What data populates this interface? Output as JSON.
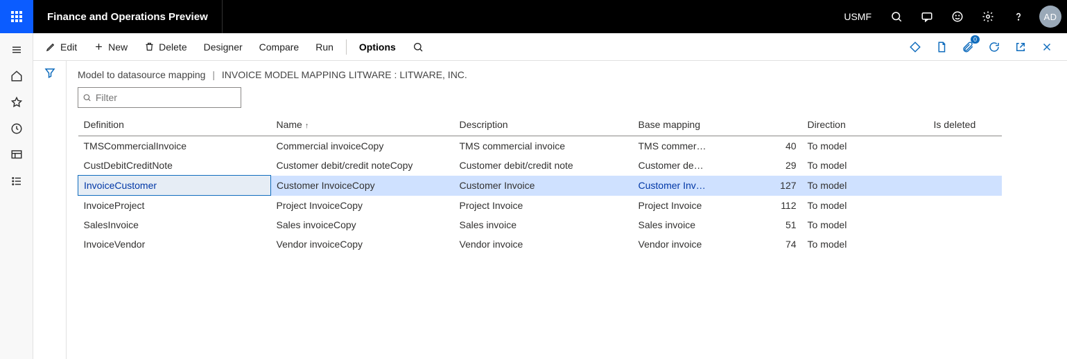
{
  "topbar": {
    "product": "Finance and Operations Preview",
    "company": "USMF",
    "avatar": "AD"
  },
  "toolbar": {
    "edit": "Edit",
    "new": "New",
    "delete": "Delete",
    "designer": "Designer",
    "compare": "Compare",
    "run": "Run",
    "options": "Options",
    "attach_badge": "0"
  },
  "breadcrumb": {
    "a": "Model to datasource mapping",
    "b": "INVOICE MODEL MAPPING LITWARE : LITWARE, INC."
  },
  "filter": {
    "placeholder": "Filter"
  },
  "columns": {
    "definition": "Definition",
    "name": "Name",
    "description": "Description",
    "base": "Base mapping",
    "direction": "Direction",
    "deleted": "Is deleted"
  },
  "rows": [
    {
      "definition": "TMSCommercialInvoice",
      "name": "Commercial invoiceCopy",
      "description": "TMS commercial invoice",
      "base": "TMS commer…",
      "num": "40",
      "direction": "To model",
      "deleted": ""
    },
    {
      "definition": "CustDebitCreditNote",
      "name": "Customer debit/credit noteCopy",
      "description": "Customer debit/credit note",
      "base": "Customer de…",
      "num": "29",
      "direction": "To model",
      "deleted": ""
    },
    {
      "definition": "InvoiceCustomer",
      "name": "Customer InvoiceCopy",
      "description": "Customer Invoice",
      "base": "Customer Inv…",
      "num": "127",
      "direction": "To model",
      "deleted": ""
    },
    {
      "definition": "InvoiceProject",
      "name": "Project InvoiceCopy",
      "description": "Project Invoice",
      "base": "Project Invoice",
      "num": "112",
      "direction": "To model",
      "deleted": ""
    },
    {
      "definition": "SalesInvoice",
      "name": "Sales invoiceCopy",
      "description": "Sales invoice",
      "base": "Sales invoice",
      "num": "51",
      "direction": "To model",
      "deleted": ""
    },
    {
      "definition": "InvoiceVendor",
      "name": "Vendor invoiceCopy",
      "description": "Vendor invoice",
      "base": "Vendor invoice",
      "num": "74",
      "direction": "To model",
      "deleted": ""
    }
  ],
  "selected_index": 2
}
